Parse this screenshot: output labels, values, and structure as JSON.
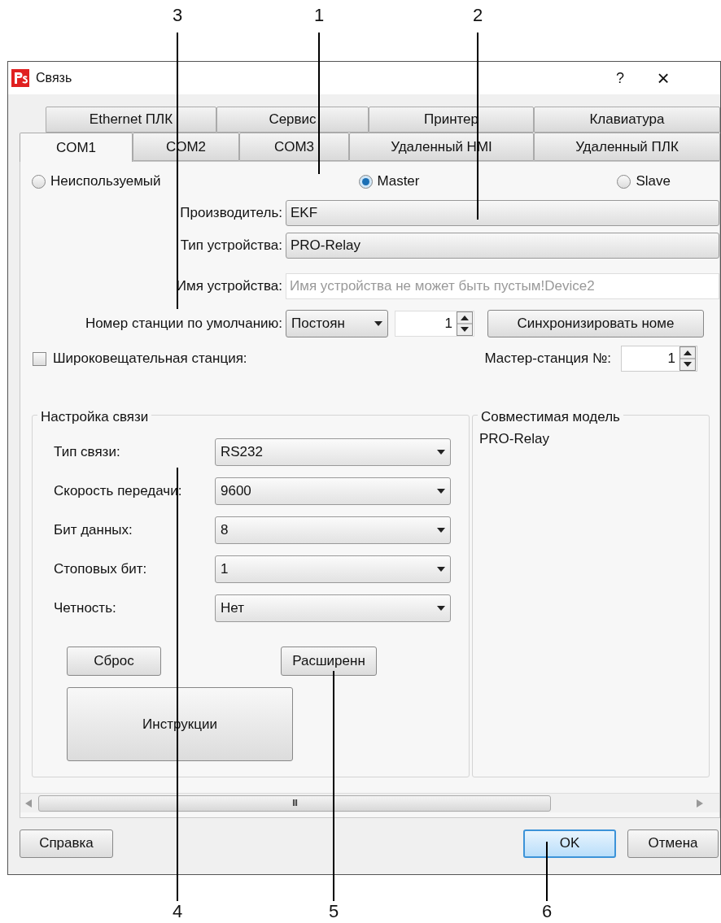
{
  "window": {
    "title": "Связь",
    "help": "?",
    "close": "×"
  },
  "tabs": [
    [
      {
        "label": "Ethernet ПЛК",
        "selected": false
      },
      {
        "label": "Сервис",
        "selected": false
      },
      {
        "label": "Принтер",
        "selected": false
      },
      {
        "label": "Клавиатура",
        "selected": false
      }
    ],
    [
      {
        "label": "COM1",
        "selected": true
      },
      {
        "label": "COM2",
        "selected": false
      },
      {
        "label": "COM3",
        "selected": false
      },
      {
        "label": "Удаленный HMI",
        "selected": false
      },
      {
        "label": "Удаленный ПЛК",
        "selected": false
      }
    ]
  ],
  "mode": [
    {
      "label": "Неиспользуемый",
      "selected": false
    },
    {
      "label": "Master",
      "selected": true
    },
    {
      "label": "Slave",
      "selected": false
    }
  ],
  "manufacturer": {
    "label": "Производитель:",
    "value": "EKF"
  },
  "device_type": {
    "label": "Тип устройства:",
    "value": "PRO-Relay"
  },
  "device_name": {
    "label": "Имя устройства:",
    "placeholder": "Имя устройства не может быть пустым!Device2"
  },
  "station": {
    "label": "Номер станции по умолчанию:",
    "mode": "Постоян",
    "number": "1",
    "sync_button": "Синхронизировать номе"
  },
  "broadcast": {
    "label": "Широковещательная станция:",
    "checked": false
  },
  "master_station": {
    "label": "Мастер-станция №:",
    "value": "1"
  },
  "comm_settings": {
    "title": "Настройка связи",
    "rows": [
      {
        "label": "Тип связи:",
        "value": "RS232"
      },
      {
        "label": "Скорость передачи:",
        "value": "9600"
      },
      {
        "label": "Бит данных:",
        "value": "8"
      },
      {
        "label": "Стоповых бит:",
        "value": "1"
      },
      {
        "label": "Четность:",
        "value": "Нет"
      }
    ],
    "reset_button": "Сброс",
    "advanced_button": "Расширенн",
    "instructions_button": "Инструкции"
  },
  "compatible": {
    "title": "Совместимая модель",
    "items": [
      "PRO-Relay"
    ]
  },
  "scrollbar_grip": "III",
  "footer": {
    "help": "Справка",
    "ok": "OK",
    "cancel": "Отмена"
  },
  "callouts": [
    {
      "label": "3"
    },
    {
      "label": "1"
    },
    {
      "label": "2"
    },
    {
      "label": "4"
    },
    {
      "label": "5"
    },
    {
      "label": "6"
    }
  ]
}
